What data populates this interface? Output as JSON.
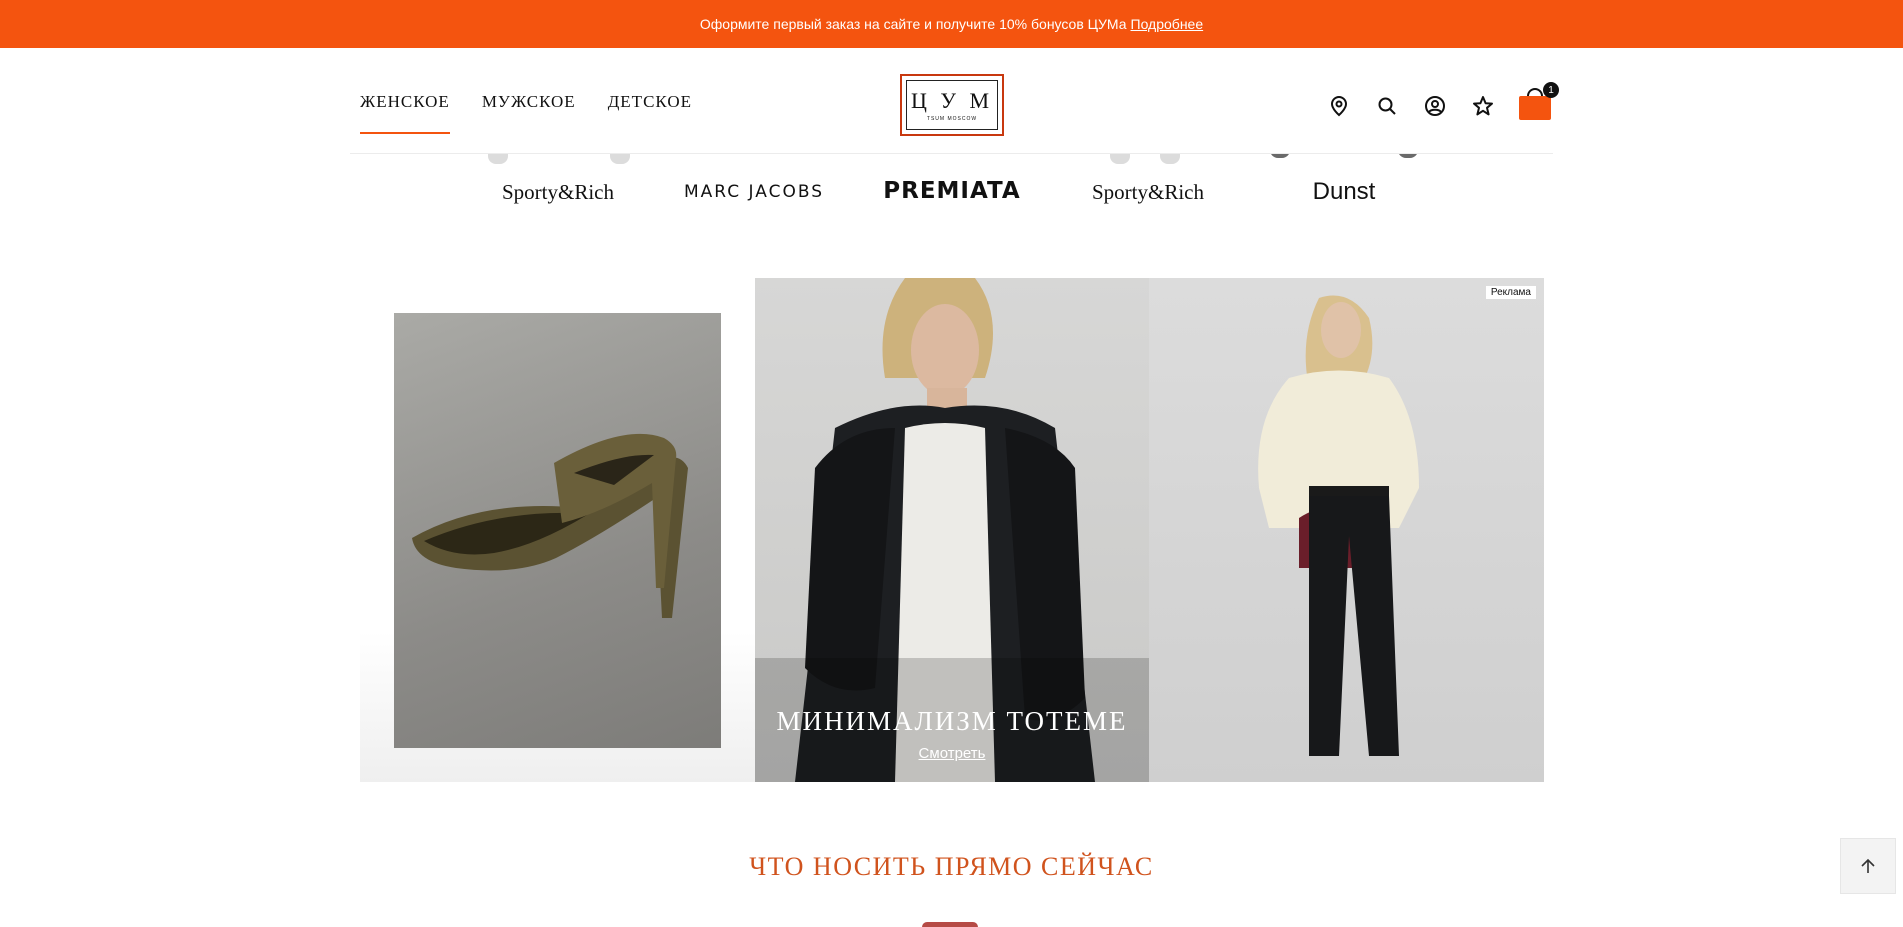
{
  "promo": {
    "text": "Оформите первый заказ на сайте и получите 10% бонусов ЦУМа",
    "link": "Подробнее"
  },
  "header": {
    "nav": [
      {
        "label": "ЖЕНСКОЕ",
        "active": true
      },
      {
        "label": "МУЖСКОЕ",
        "active": false
      },
      {
        "label": "ДЕТСКОЕ",
        "active": false
      }
    ],
    "logo": {
      "letters": "Ц У М",
      "sub": "TSUM MOSCOW"
    },
    "icons": [
      "location-pin-icon",
      "search-icon",
      "account-icon",
      "favorites-star-icon",
      "cart-bag-icon"
    ],
    "cart_count": "1"
  },
  "brands": [
    "Sporty&Rich",
    "MARC JACOBS",
    "PREMIATA",
    "Sporty&Rich",
    "Dunst"
  ],
  "banner": {
    "ad_label": "Реклама",
    "title": "МИНИМАЛИЗМ TOTEME",
    "link": "Смотреть"
  },
  "section_title": "ЧТО НОСИТЬ ПРЯМО СЕЙЧАС",
  "colors": {
    "accent": "#f4540f",
    "section_title": "#d0531d"
  }
}
